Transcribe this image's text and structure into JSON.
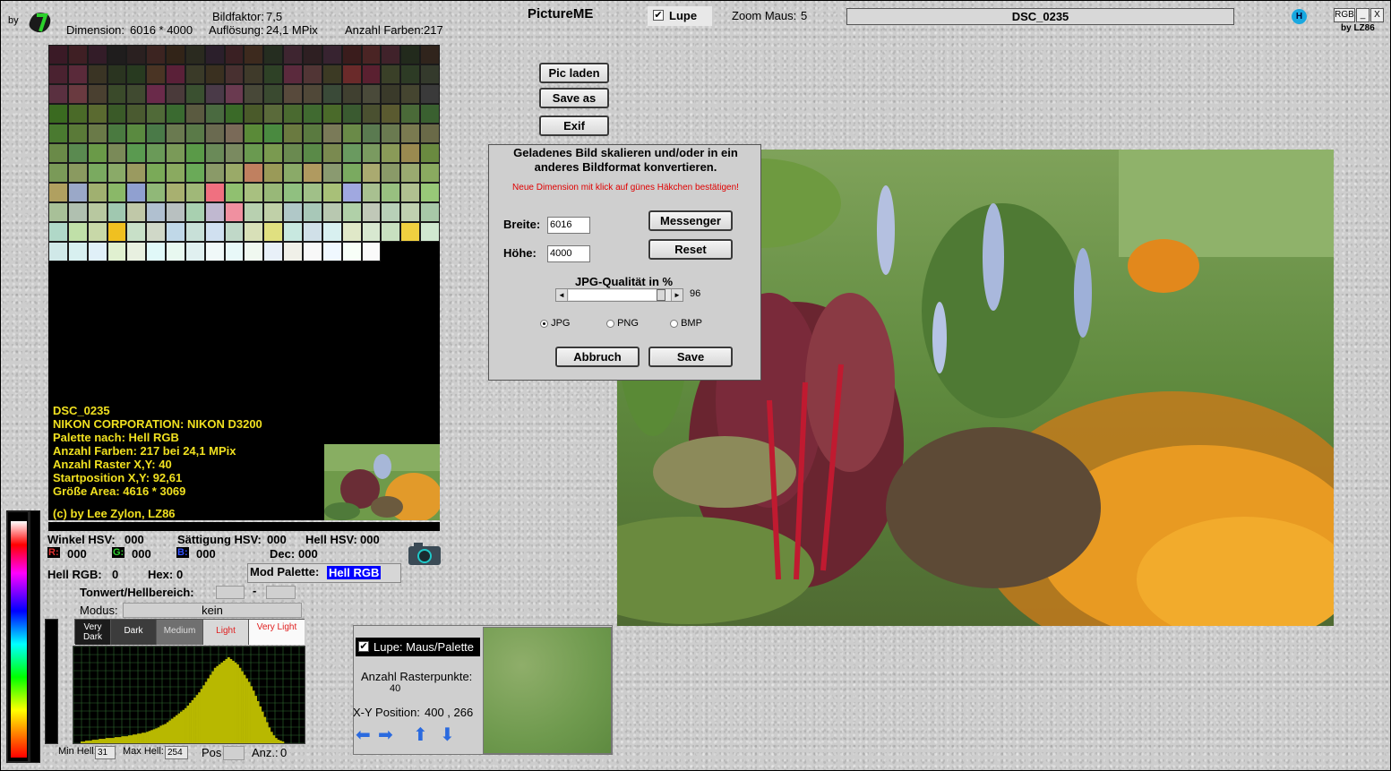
{
  "header": {
    "by": "by",
    "dimension_label": "Dimension:",
    "dimension_value": "6016 * 4000",
    "bildfaktor_label": "Bildfaktor:",
    "bildfaktor_value": "7,5",
    "aufloesung_label": "Auflösung:",
    "aufloesung_value": "24,1 MPix",
    "anzahl_farben_label": "Anzahl Farben:",
    "anzahl_farben_value": "217",
    "app_title": "PictureME",
    "lupe_label": "Lupe",
    "lupe_checked": "✔",
    "zoom_label": "Zoom Maus:",
    "zoom_value": "5",
    "filename": "DSC_0235",
    "rgb_btn": "RGB",
    "min_btn": "_",
    "close_btn": "X",
    "by_lz86": "by LZ86",
    "help_icon": "H"
  },
  "toolbar": {
    "pic_laden": "Pic laden",
    "save_as": "Save as",
    "exif": "Exif"
  },
  "dialog": {
    "title": "Geladenes Bild skalieren und/oder in ein anderes Bildformat konvertieren.",
    "notice": "Neue Dimension mit klick auf günes Häkchen bestätigen!",
    "breite_label": "Breite:",
    "breite_value": "6016",
    "hoehe_label": "Höhe:",
    "hoehe_value": "4000",
    "messenger": "Messenger",
    "reset": "Reset",
    "jpg_quality_label": "JPG-Qualität in %",
    "jpg_quality_value": "96",
    "jpg_quality_fraction": 0.96,
    "formats": [
      "JPG",
      "PNG",
      "BMP"
    ],
    "format_selected": "JPG",
    "abbruch": "Abbruch",
    "save": "Save"
  },
  "palette_info": {
    "lines": [
      "DSC_0235",
      "NIKON CORPORATION: NIKON D3200",
      "Palette nach: Hell RGB",
      "Anzahl Farben: 217  bei 24,1 MPix",
      "Anzahl Raster X,Y: 40",
      "Startposition X,Y: 92,61",
      "Größe Area: 4616 * 3069"
    ],
    "copyright": "(c) by Lee Zylon, LZ86"
  },
  "palette_colors": [
    "#3a1a26",
    "#3f1f24",
    "#331c28",
    "#1f1d1d",
    "#2a2020",
    "#3c2421",
    "#322418",
    "#2a2a1f",
    "#2b1f2b",
    "#3a2023",
    "#3d2a1e",
    "#252d20",
    "#3e2530",
    "#2e1f22",
    "#372330",
    "#3a1c1c",
    "#4a2424",
    "#40222a",
    "#222a1c",
    "#30241c",
    "#4a2230",
    "#5a2a3a",
    "#3a3424",
    "#2a3420",
    "#283a20",
    "#4a3424",
    "#5a2038",
    "#3a3a28",
    "#3a3020",
    "#483030",
    "#3f3a2a",
    "#2e4126",
    "#5b2a3d",
    "#513535",
    "#3c3a24",
    "#6a2a2a",
    "#5a2030",
    "#3a4028",
    "#2d3b25",
    "#343a2c",
    "#5a3040",
    "#6a3a40",
    "#4a4030",
    "#3a4a2a",
    "#404a30",
    "#6a2a4a",
    "#4a3a3a",
    "#3a5030",
    "#4a3a48",
    "#6a3a50",
    "#484838",
    "#3a4a30",
    "#584a3c",
    "#504838",
    "#3a4a38",
    "#404030",
    "#4a4a3a",
    "#3a3a2a",
    "#454530",
    "#3a3a3a",
    "#3a6a20",
    "#4a6a28",
    "#5a6a30",
    "#3a5a28",
    "#4a5a30",
    "#506a38",
    "#3a6a30",
    "#5a5a40",
    "#4a6a40",
    "#3a6a28",
    "#4a5a2a",
    "#5a6a3a",
    "#4a6a30",
    "#406a30",
    "#4a6a2a",
    "#3a5a30",
    "#4a5030",
    "#5a5a30",
    "#4a6a38",
    "#3a6030",
    "#4a7a30",
    "#5a7a38",
    "#6a7a48",
    "#4a7a40",
    "#5a8a40",
    "#4a7a48",
    "#6a7a50",
    "#5a7a48",
    "#6a6a50",
    "#7a6a58",
    "#5a8a38",
    "#4a8a40",
    "#6a7a40",
    "#5a7a40",
    "#7a7a58",
    "#6a8a48",
    "#5a7a50",
    "#6a7a50",
    "#7a7a50",
    "#6a6a48",
    "#6a8a48",
    "#5a8a50",
    "#6a9a48",
    "#7a8a58",
    "#5a9a50",
    "#6a9a58",
    "#7a9a58",
    "#5a9a48",
    "#6a8a58",
    "#7a8a60",
    "#6a9a50",
    "#7a9a50",
    "#6a8a50",
    "#5a8a48",
    "#7a8a50",
    "#6a9a60",
    "#7a9a60",
    "#8a9a58",
    "#9a8a50",
    "#6a8a40",
    "#7a9a58",
    "#8a9a60",
    "#7aaa60",
    "#8aaa68",
    "#9a9a60",
    "#7aaa58",
    "#8aaa60",
    "#6aaa58",
    "#8a9a68",
    "#9aaa68",
    "#c08060",
    "#9a9a58",
    "#8aaa68",
    "#b09a60",
    "#8a9a70",
    "#7aaa60",
    "#aaaa70",
    "#8a9a68",
    "#9aaa70",
    "#8aaa60",
    "#b0a060",
    "#9aa8c8",
    "#a0b070",
    "#8ab868",
    "#90a0d0",
    "#90b878",
    "#a8b070",
    "#a0b878",
    "#f07080",
    "#90c070",
    "#a8c080",
    "#98b878",
    "#90c080",
    "#a0c088",
    "#a8c078",
    "#a0a8e0",
    "#a8c090",
    "#98c080",
    "#b0c090",
    "#98c878",
    "#a8c098",
    "#b0c0b0",
    "#b8c8a0",
    "#a0c8b0",
    "#c0c8a8",
    "#b0c0d0",
    "#b8c0c0",
    "#a8d0b0",
    "#c0b8d0",
    "#f090a0",
    "#b8d0b0",
    "#c0d0a8",
    "#b0c8c8",
    "#a8c8b8",
    "#b8c8b0",
    "#b0d0a8",
    "#c0c8b8",
    "#b8d0b8",
    "#c0d0b0",
    "#a8c8a8",
    "#b0d8c8",
    "#c0e0a8",
    "#c8d8a8",
    "#f0c020",
    "#c8e0c8",
    "#d0d8c8",
    "#c0d8e8",
    "#c8e0d8",
    "#d0e0f0",
    "#c0d8c8",
    "#d8e0b8",
    "#e0e080",
    "#c8e8e0",
    "#d0e0e8",
    "#d8f0f0",
    "#e0e8c8",
    "#d8e8d0",
    "#c8e0c0",
    "#f0d040",
    "#d0e8d0",
    "#d0e8e8",
    "#d8f0f0",
    "#e0f0f8",
    "#e0f0d0",
    "#e8f0e0",
    "#e0f8f8",
    "#e8f8f0",
    "#e0f0f0",
    "#f0f8f8",
    "#e8f8f8",
    "#f0f8f0",
    "#e8f0f8",
    "#f0f0e8",
    "#f8f8f8",
    "#f0f8ff",
    "#f8fff8",
    "#fafafa"
  ],
  "hsv": {
    "winkel_label": "Winkel HSV:",
    "winkel_value": "000",
    "saettigung_label": "Sättigung HSV:",
    "saettigung_value": "000",
    "hell_label": "Hell HSV:",
    "hell_value": "000",
    "r_label": "R:",
    "r_value": "000",
    "g_label": "G:",
    "g_value": "000",
    "b_label": "B:",
    "b_value": "000",
    "dec_label": "Dec:",
    "dec_value": "000",
    "hell_rgb_label": "Hell RGB:",
    "hell_rgb_value": "0",
    "hex_label": "Hex:",
    "hex_value": "0",
    "mod_palette_label": "Mod Palette:",
    "mod_palette_value": "Hell RGB"
  },
  "tone": {
    "label": "Tonwert/Hellbereich:",
    "sep": "-",
    "modus_label": "Modus:",
    "modus_value": "kein",
    "buttons": [
      "Very Dark",
      "Dark",
      "Medium",
      "Light",
      "Very Light"
    ],
    "min_hell_label": "Min Hell:",
    "min_hell_value": "31",
    "max_hell_label": "Max Hell:",
    "max_hell_value": "254",
    "pos_label": "Pos",
    "anz_label": "Anz.:",
    "anz_value": "0"
  },
  "histogram": [
    2,
    2,
    3,
    3,
    3,
    4,
    4,
    4,
    5,
    5,
    5,
    6,
    6,
    6,
    6,
    7,
    7,
    7,
    8,
    8,
    8,
    9,
    9,
    10,
    10,
    11,
    11,
    12,
    12,
    13,
    14,
    15,
    16,
    17,
    18,
    20,
    21,
    22,
    24,
    26,
    28,
    30,
    32,
    34,
    36,
    38,
    40,
    43,
    46,
    49,
    52,
    55,
    58,
    62,
    66,
    70,
    74,
    78,
    82,
    86,
    88,
    90,
    92,
    94,
    96,
    98,
    96,
    94,
    92,
    90,
    86,
    82,
    78,
    74,
    70,
    65,
    60,
    54,
    48,
    42,
    36,
    30,
    24,
    18,
    13,
    9,
    6,
    4,
    3,
    2
  ],
  "lupe": {
    "label": "Lupe: Maus/Palette",
    "checked": "✔",
    "rasterpunkte_label": "Anzahl Rasterpunkte:",
    "rasterpunkte_value": "40",
    "xy_label": "X-Y Position:",
    "xy_value": "400 , 266"
  },
  "colors": {
    "accent_blue": "#0000ff",
    "info_yellow": "#f0e020",
    "notice_red": "#e00000",
    "histogram_fill": "#b8b800",
    "histogram_grid": "#2f6a2f"
  }
}
